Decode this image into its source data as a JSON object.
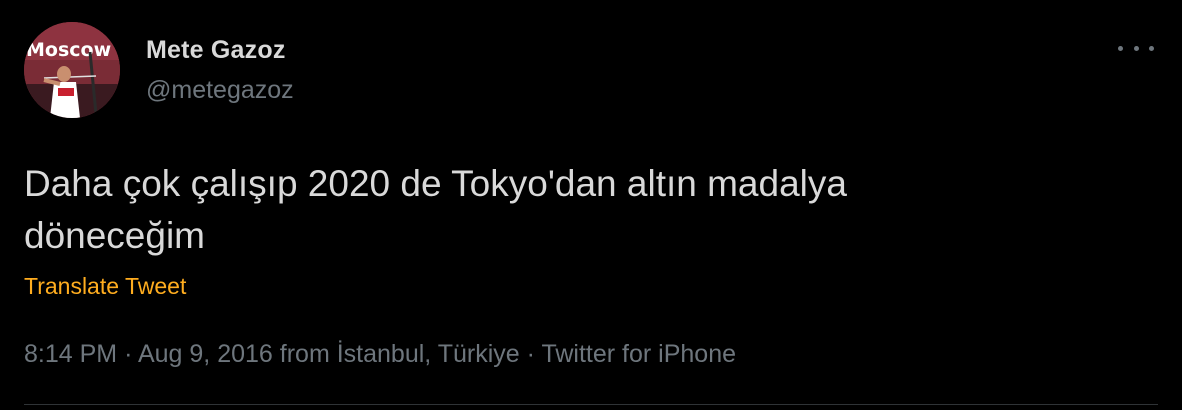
{
  "author": {
    "name": "Mete Gazoz",
    "handle": "@metegazoz",
    "avatar_text": "Moscow"
  },
  "tweet": {
    "text_line1": "Daha çok çalışıp 2020 de Tokyo'dan altın madalya",
    "text_line2": "döneceğim",
    "translate_label": "Translate Tweet"
  },
  "meta": {
    "time": "8:14 PM",
    "date": "Aug 9, 2016",
    "from_label": "from",
    "location": "İstanbul, Türkiye",
    "source": "Twitter for iPhone",
    "separator": "·"
  },
  "colors": {
    "background": "#000000",
    "text": "#d9d9d9",
    "muted": "#6e767d",
    "accent": "#ffad1f"
  },
  "icons": {
    "more": "more-horizontal-icon"
  }
}
